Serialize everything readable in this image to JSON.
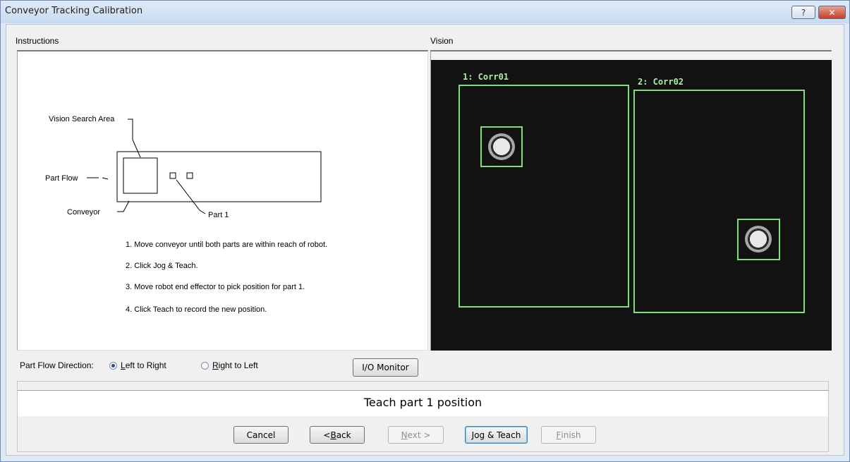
{
  "window": {
    "title": "Conveyor Tracking Calibration",
    "help_label": "?",
    "close_label": "✕"
  },
  "instructions": {
    "label": "Instructions",
    "diagram": {
      "vision_search_area": "Vision Search Area",
      "part_flow": "Part Flow",
      "conveyor": "Conveyor",
      "part1": "Part 1"
    },
    "steps": [
      "1. Move conveyor until both parts are within reach of robot.",
      "2. Click Jog & Teach.",
      "3. Move robot end effector to pick position for part 1.",
      "4. Click Teach to record the new position."
    ]
  },
  "vision": {
    "label": "Vision",
    "roi": [
      {
        "label": "1: Corr01"
      },
      {
        "label": "2: Corr02"
      }
    ],
    "roi_color": "#7de07d"
  },
  "part_flow": {
    "label": "Part Flow Direction:",
    "options": [
      {
        "prefix": "",
        "accel": "L",
        "rest": "eft to Right",
        "selected": true
      },
      {
        "prefix": "",
        "accel": "R",
        "rest": "ight to Left",
        "selected": false
      }
    ]
  },
  "io_monitor": {
    "label": "I/O Monitor"
  },
  "status": {
    "text": "Teach part 1 position"
  },
  "buttons": {
    "cancel": "Cancel",
    "back_prefix": "< ",
    "back_accel": "B",
    "back_rest": "ack",
    "next_accel": "N",
    "next_rest": "ext >",
    "jog_teach": "Jog & Teach",
    "finish_accel": "F",
    "finish_rest": "inish"
  }
}
